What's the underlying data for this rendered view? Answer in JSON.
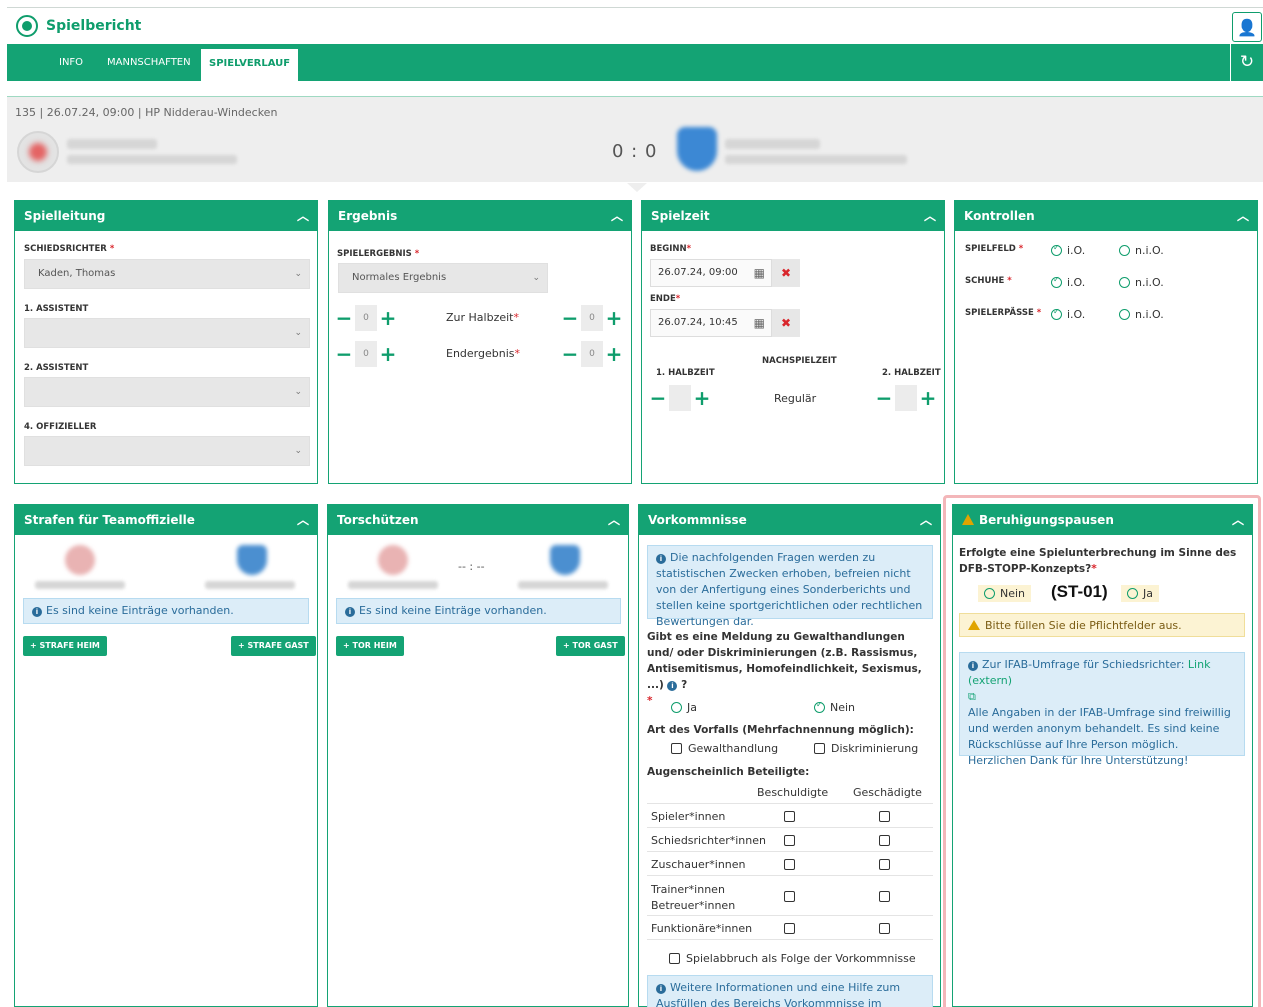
{
  "app": {
    "title": "Spielbericht"
  },
  "nav": {
    "tabs": [
      "INFO",
      "MANNSCHAFTEN",
      "SPIELVERLAUF"
    ],
    "active": "SPIELVERLAUF"
  },
  "match": {
    "meta": "135 | 26.07.24, 09:00 | HP Nidderau-Windecken",
    "score": "0 : 0"
  },
  "spielleitung": {
    "title": "Spielleitung",
    "schiedsrichter_label": "SCHIEDSRICHTER",
    "schiedsrichter_value": "Kaden, Thomas",
    "assistent1_label": "1. ASSISTENT",
    "assistent2_label": "2. ASSISTENT",
    "offizieller_label": "4. OFFIZIELLER"
  },
  "ergebnis": {
    "title": "Ergebnis",
    "spielergebnis_label": "SPIELERGEBNIS",
    "spielergebnis_value": "Normales Ergebnis",
    "halbzeit_label": "Zur Halbzeit",
    "endergebnis_label": "Endergebnis",
    "values": [
      "0",
      "0",
      "0",
      "0"
    ]
  },
  "spielzeit": {
    "title": "Spielzeit",
    "beginn_label": "BEGINN",
    "beginn_value": "26.07.24, 09:00",
    "ende_label": "ENDE",
    "ende_value": "26.07.24, 10:45",
    "nachspielzeit_label": "NACHSPIELZEIT",
    "halbzeit1_label": "1. HALBZEIT",
    "halbzeit2_label": "2. HALBZEIT",
    "regular_label": "Regulär"
  },
  "kontrollen": {
    "title": "Kontrollen",
    "rows": [
      {
        "label": "SPIELFELD",
        "io": "i.O.",
        "nio": "n.i.O."
      },
      {
        "label": "SCHUHE",
        "io": "i.O.",
        "nio": "n.i.O."
      },
      {
        "label": "SPIELERPÄSSE",
        "io": "i.O.",
        "nio": "n.i.O."
      }
    ]
  },
  "strafen": {
    "title": "Strafen für Teamoffizielle",
    "empty": "Es sind keine Einträge vorhanden.",
    "btn_heim": "STRAFE HEIM",
    "btn_gast": "STRAFE GAST"
  },
  "torschuetzen": {
    "title": "Torschützen",
    "score": "-- : --",
    "empty": "Es sind keine Einträge vorhanden.",
    "btn_heim": "TOR HEIM",
    "btn_gast": "TOR GAST"
  },
  "vorkommnisse": {
    "title": "Vorkommnisse",
    "info": "Die nachfolgenden Fragen werden zu statistischen Zwecken erhoben, befreien nicht von der Anfertigung eines Sonderberichts und stellen keine sportgerichtlichen oder rechtlichen Bewertungen dar.",
    "question": "Gibt es eine Meldung zu Gewalthandlungen und/ oder Diskriminierungen (z.B. Rassismus, Antisemitismus, Homofeindlichkeit, Sexismus, ...)",
    "ja": "Ja",
    "nein": "Nein",
    "art_label": "Art des Vorfalls (Mehrfachnennung möglich):",
    "gewalt": "Gewalthandlung",
    "diskriminierung": "Diskriminierung",
    "beteiligte_label": "Augenscheinlich Beteiligte:",
    "col_beschuldigte": "Beschuldigte",
    "col_geschaedigte": "Geschädigte",
    "rows": [
      "Spieler*innen",
      "Schiedsrichter*innen",
      "Zuschauer*innen",
      "Trainer*innen Betreuer*innen",
      "Funktionäre*innen"
    ],
    "abbruch": "Spielabbruch als Folge der Vorkommnisse",
    "info2": "Weitere Informationen und eine Hilfe zum Ausfüllen des Bereichs Vorkommnisse im Spielbericht"
  },
  "beruhigung": {
    "title": "Beruhigungspausen",
    "question": "Erfolgte eine Spielunterbrechung im Sinne des DFB-STOPP-Konzepts?",
    "nein": "Nein",
    "code": "(ST-01)",
    "ja": "Ja",
    "warning": "Bitte füllen Sie die Pflichtfelder aus.",
    "ifab_text": "Zur IFAB-Umfrage für Schiedsrichter:",
    "ifab_link": "Link (extern)",
    "ifab_info": "Alle Angaben in der IFAB-Umfrage sind freiwillig und werden anonym behandelt. Es sind keine Rückschlüsse auf Ihre Person möglich. Herzlichen Dank für Ihre Unterstützung!"
  },
  "colors": {
    "accent": "#14a374",
    "danger": "#d9262c",
    "info": "#dcedf8",
    "warning": "#fcf3d3"
  }
}
